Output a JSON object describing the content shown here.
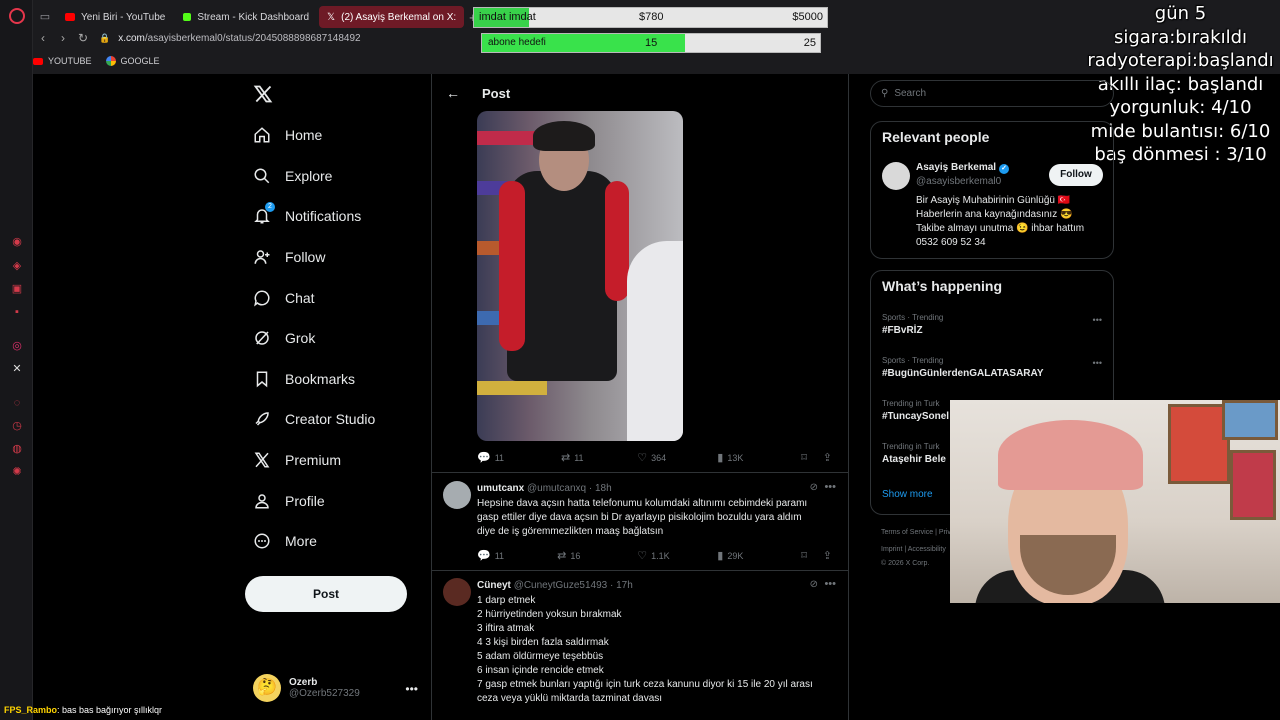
{
  "browser": {
    "tabs": [
      {
        "label": "Yeni Biri - YouTube",
        "icon": "youtube-icon"
      },
      {
        "label": "Stream - Kick Dashboard",
        "icon": "kick-icon"
      },
      {
        "label": "(2) Asayiş Berkemal on X:",
        "icon": "x-icon",
        "active": true
      }
    ],
    "url_host": "x.com",
    "url_path": "/asayisberkemal0/status/2045088898687148492",
    "bookmarks": [
      "YOUTUBE",
      "GOOGLE"
    ]
  },
  "goals": {
    "donation": {
      "label": "imdat imdat",
      "current": "$780",
      "target": "$5000",
      "progress": 0.156
    },
    "subs": {
      "label": "abone hedefi",
      "current": "15",
      "target": "25",
      "progress": 0.6
    }
  },
  "stream_stats": [
    "gün 5",
    "sigara:bırakıldı",
    "radyoterapi:başlandı",
    "akıllı ilaç: başlandı",
    "yorgunluk:  4/10",
    "mide bulantısı: 6/10",
    "baş dönmesi : 3/10"
  ],
  "nav": {
    "items": [
      {
        "label": "Home",
        "icon": "home-icon"
      },
      {
        "label": "Explore",
        "icon": "search-icon"
      },
      {
        "label": "Notifications",
        "icon": "bell-icon",
        "badge": "2"
      },
      {
        "label": "Follow",
        "icon": "add-person-icon"
      },
      {
        "label": "Chat",
        "icon": "chat-bubble-icon"
      },
      {
        "label": "Grok",
        "icon": "grok-icon"
      },
      {
        "label": "Bookmarks",
        "icon": "bookmark-icon"
      },
      {
        "label": "Creator Studio",
        "icon": "rocket-icon"
      },
      {
        "label": "Premium",
        "icon": "x-icon"
      },
      {
        "label": "Profile",
        "icon": "person-icon"
      },
      {
        "label": "More",
        "icon": "more-circle-icon"
      }
    ],
    "post_button": "Post",
    "user": {
      "name": "Ozerb",
      "handle": "@Ozerb527329",
      "avatar": "🤔"
    }
  },
  "main": {
    "header_title": "Post",
    "post_actions": {
      "replies": "11",
      "reposts": "11",
      "likes": "364",
      "views": "13K"
    },
    "replies": [
      {
        "name": "umutcanx",
        "handle": "@umutcanxq",
        "time": "· 18h",
        "text": [
          "Hepsine dava açsın hatta telefonumu kolumdaki altınımı cebimdeki paramı",
          "gasp ettiler diye dava açsın bi Dr ayarlayıp pisikolojim bozuldu yara aldım",
          "diye de iş göremmezlikten maaş bağlatsın"
        ],
        "actions": {
          "replies": "11",
          "reposts": "16",
          "likes": "1.1K",
          "views": "29K"
        }
      },
      {
        "name": "Cüneyt",
        "handle": "@CuneytGuze51493",
        "time": "· 17h",
        "text": [
          "1 darp etmek",
          "2 hürriyetinden yoksun bırakmak",
          "3 iftira atmak",
          "4 3 kişi birden fazla saldırmak",
          "5 adam öldürmeye teşebbüs",
          "6 insan içinde rencide etmek",
          "7 gasp etmek bunları yaptığı için turk ceza kanunu diyor ki 15 ile 20 yıl arası",
          "ceza veya yüklü miktarda tazminat davası"
        ]
      }
    ]
  },
  "right": {
    "search_placeholder": "Search",
    "relevant_title": "Relevant people",
    "person": {
      "name": "Asayiş Berkemal",
      "handle": "@asayisberkemal0",
      "follow_label": "Follow",
      "bio": [
        "Bir Asayiş Muhabirinin Günlüğü 🇹🇷",
        "Haberlerin ana kaynağındasınız 😎",
        "Takibe almayı unutma 😉 ihbar hattım",
        "0532 609 52 34"
      ]
    },
    "happening_title": "What’s happening",
    "trends": [
      {
        "category": "Sports · Trending",
        "name": "#FBvRİZ"
      },
      {
        "category": "Sports · Trending",
        "name": "#BugünGünlerdenGALATASARAY"
      },
      {
        "category": "Trending in Turk",
        "name": "#TuncaySonel"
      },
      {
        "category": "Trending in Turk",
        "name": "Ataşehir Bele"
      }
    ],
    "show_more": "Show more",
    "legal": [
      "Terms of Service  |  Privacy Policy",
      "Imprint  |  Accessibility",
      "© 2026 X Corp."
    ]
  },
  "chat": {
    "user": "FPS_Rambo",
    "message": ": bas bas bağırıyor şıllıklqr"
  }
}
